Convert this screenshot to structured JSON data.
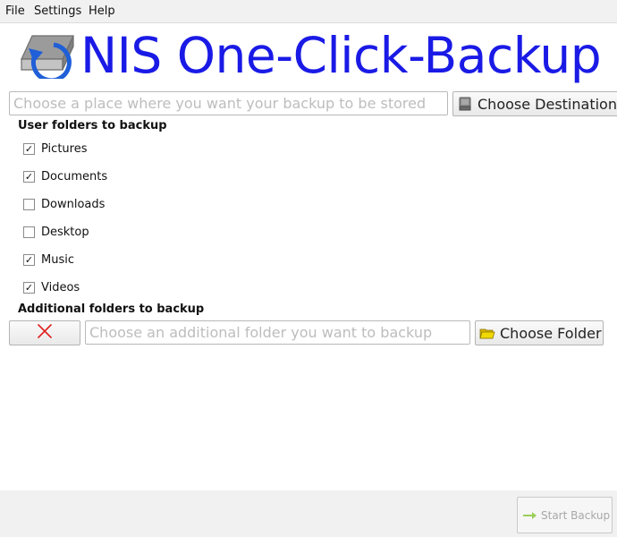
{
  "menu": {
    "file": "File",
    "settings": "Settings",
    "help": "Help"
  },
  "app": {
    "title": "NIS One-Click-Backup",
    "title_color": "#1a1ae6"
  },
  "destination": {
    "placeholder": "Choose a place where you want your backup to be stored",
    "value": "",
    "button_label": "Choose Destination",
    "button_icon": "drive-icon"
  },
  "user_folders": {
    "heading": "User folders to backup",
    "items": [
      {
        "label": "Pictures",
        "checked": true,
        "mark": "✓"
      },
      {
        "label": "Documents",
        "checked": true,
        "mark": "✓"
      },
      {
        "label": "Downloads",
        "checked": false,
        "mark": ""
      },
      {
        "label": "Desktop",
        "checked": false,
        "mark": ""
      },
      {
        "label": "Music",
        "checked": true,
        "mark": "✓"
      },
      {
        "label": "Videos",
        "checked": true,
        "mark": "✓"
      }
    ]
  },
  "additional": {
    "heading": "Additional folders to backup",
    "remove_icon": "close-icon",
    "placeholder": "Choose an additional folder you want to backup",
    "value": "",
    "button_label": "Choose Folder",
    "button_icon": "folder-icon"
  },
  "footer": {
    "start_label": "Start Backup",
    "start_icon": "arrow-right-icon",
    "start_enabled": false
  }
}
